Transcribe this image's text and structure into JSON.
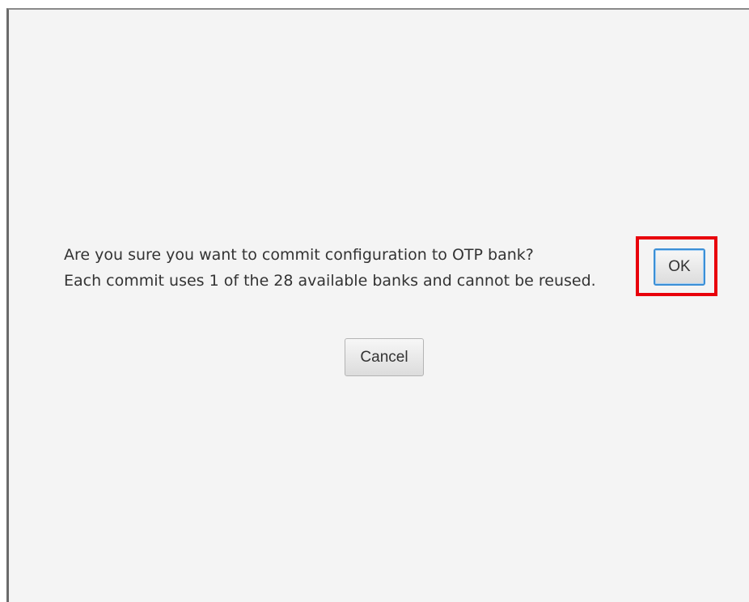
{
  "dialog": {
    "message_line1": "Are you sure you want to commit configuration to OTP bank?",
    "message_line2": "Each commit uses 1 of the 28 available banks and cannot be reused.",
    "ok_label": "OK",
    "cancel_label": "Cancel"
  },
  "colors": {
    "dialog_background": "#f4f4f4",
    "highlight_border": "#e8000b",
    "focus_border": "#3b8fd6"
  }
}
